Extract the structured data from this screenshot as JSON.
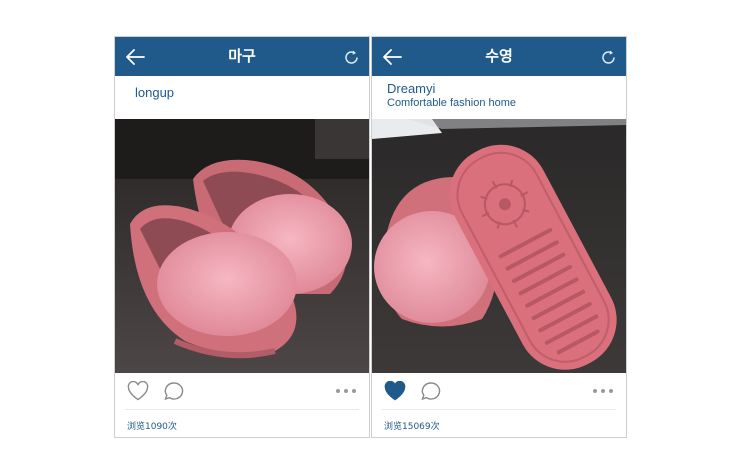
{
  "posts": [
    {
      "header": {
        "title": "마구",
        "back_icon": "arrow-left-icon",
        "refresh_icon": "refresh-icon"
      },
      "username": "longup",
      "tagline": "",
      "liked": false,
      "views_label": "浏览1090次"
    },
    {
      "header": {
        "title": "수영",
        "back_icon": "arrow-left-icon",
        "refresh_icon": "refresh-icon"
      },
      "username": "Dreamyi",
      "tagline": "Comfortable fashion home",
      "liked": true,
      "views_label": "浏览15069次"
    }
  ],
  "colors": {
    "accent": "#1f5a8a",
    "slipper": "#d97b84",
    "fur": "#eea0ad"
  }
}
